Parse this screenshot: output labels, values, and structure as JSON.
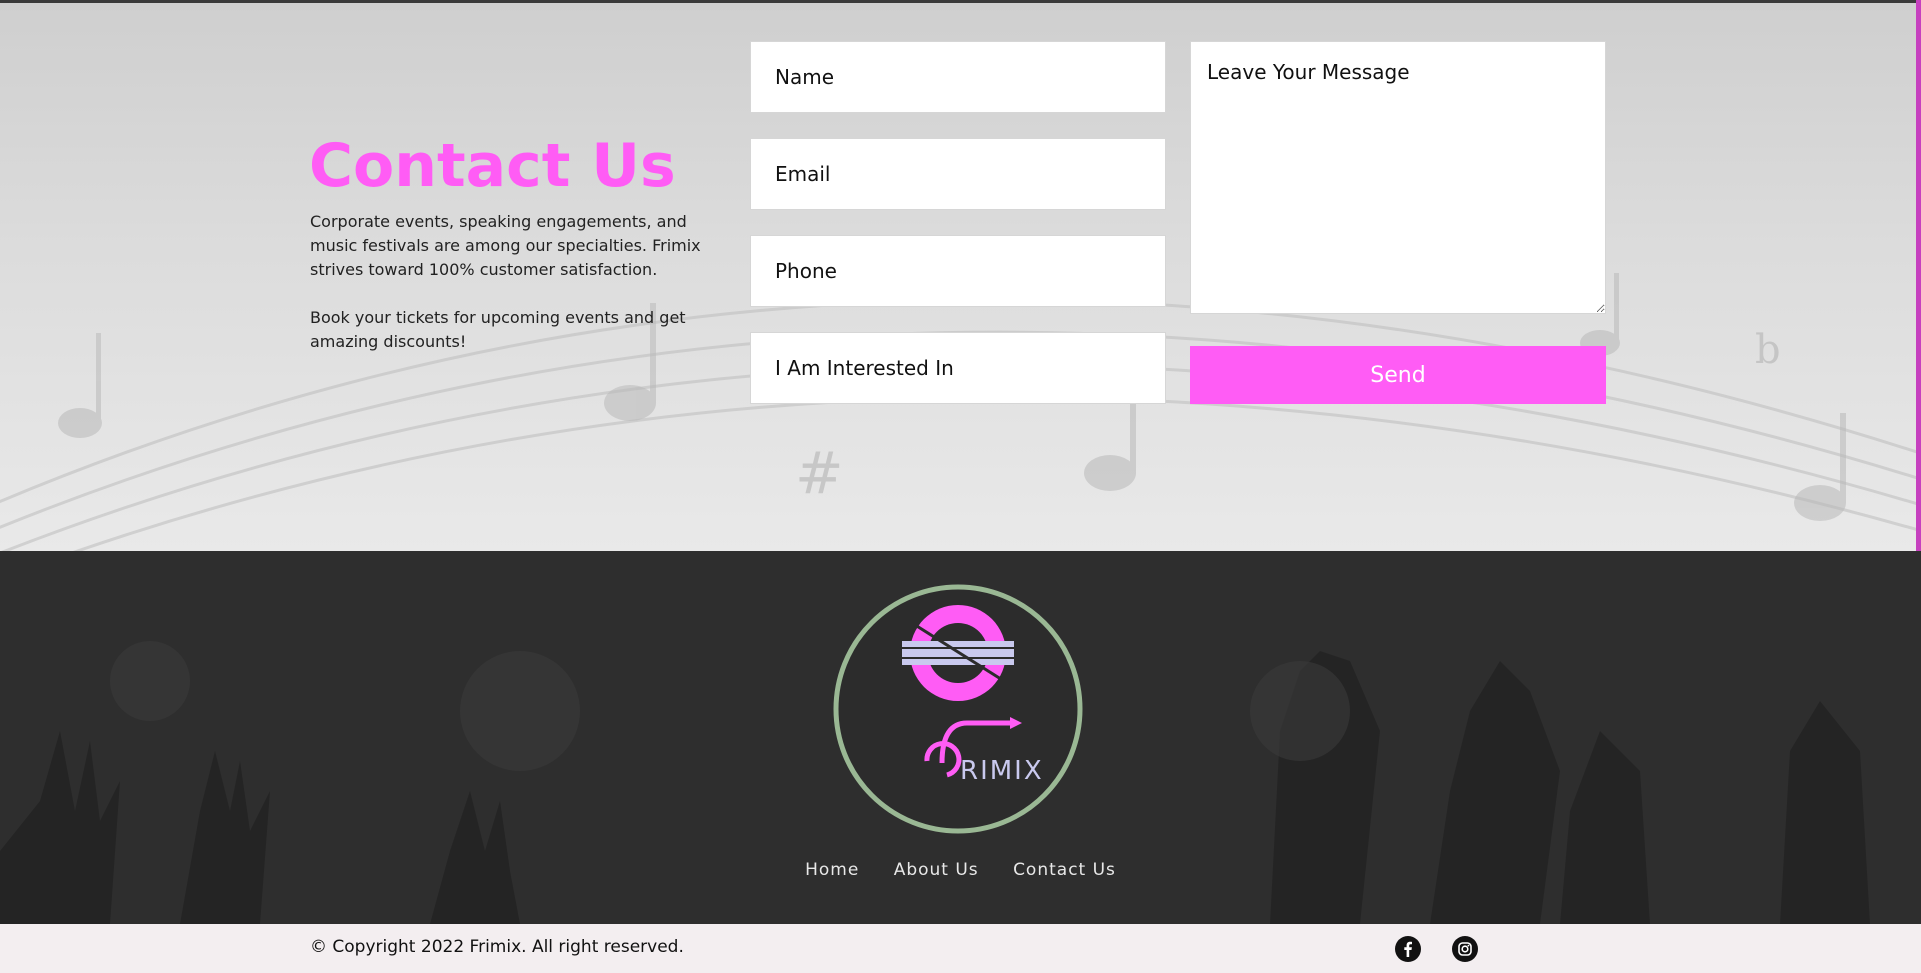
{
  "contact": {
    "title": "Contact Us",
    "paragraph1": "Corporate events, speaking engagements, and music festivals are among our specialties. Frimix strives toward 100% customer satisfaction.",
    "paragraph2": "Book your tickets for upcoming events and get amazing discounts!",
    "form": {
      "name_placeholder": "Name",
      "email_placeholder": "Email",
      "phone_placeholder": "Phone",
      "interest_placeholder": "I Am Interested In",
      "message_placeholder": "Leave Your Message",
      "send_label": "Send"
    }
  },
  "footer": {
    "logo_text": "RIMIX",
    "nav": [
      "Home",
      "About Us",
      "Contact Us"
    ]
  },
  "bottom": {
    "copyright": "© Copyright 2022 Frimix. All right reserved.",
    "social": [
      {
        "icon": "facebook-icon"
      },
      {
        "icon": "instagram-icon"
      }
    ]
  },
  "colors": {
    "accent": "#ff5cf5",
    "footer_bg": "#2e2e2e",
    "bottom_bg": "#f3eef0"
  }
}
